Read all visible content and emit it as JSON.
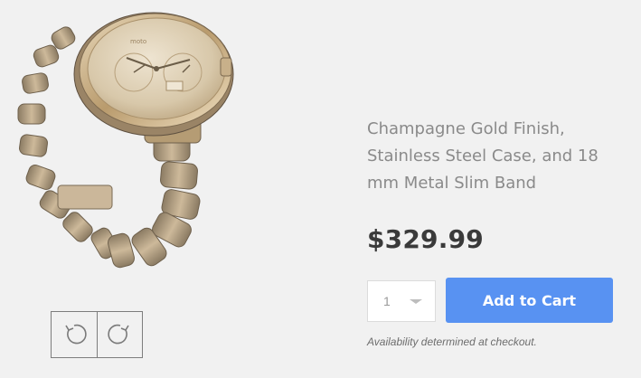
{
  "product": {
    "title": "Champagne Gold Finish, Stainless Steel Case, and 18 mm Metal Slim Band",
    "price": "$329.99",
    "image_icon": "smartwatch-image",
    "watch_face_brand": "moto"
  },
  "rotate": {
    "left_icon": "rotate-counterclockwise-icon",
    "right_icon": "rotate-clockwise-icon"
  },
  "purchase": {
    "quantity": "1",
    "add_to_cart_label": "Add to Cart",
    "availability_note": "Availability determined at checkout."
  },
  "colors": {
    "accent": "#5892f2",
    "background": "#f1f1f1",
    "gold": "#c7b08a"
  }
}
